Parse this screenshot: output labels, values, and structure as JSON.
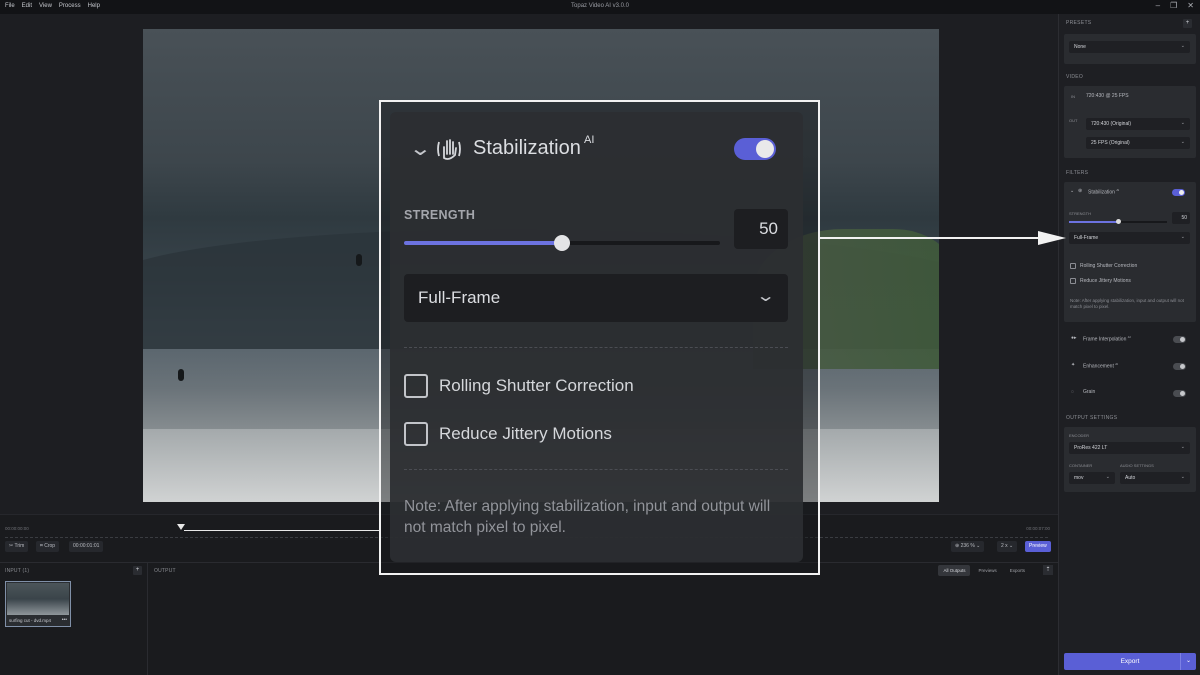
{
  "window": {
    "title": "Topaz Video AI  v3.0.0",
    "menu": [
      "File",
      "Edit",
      "View",
      "Process",
      "Help"
    ],
    "controls": [
      "–",
      "❐",
      "✕"
    ]
  },
  "timeline": {
    "start_time": "00:00:00:00",
    "end_time": "00:00:07:00",
    "trim_label": "Trim",
    "crop_label": "Crop",
    "position": "00:00:01:01",
    "zoom": "236 %",
    "speed": "2 x",
    "preview_label": "Preview"
  },
  "input_pane": {
    "label": "INPUT (1)",
    "add_label": "+",
    "file_name": "surfing cut - dvd.mp4",
    "more_label": "•••"
  },
  "output_pane": {
    "label": "OUTPUT",
    "tabs": [
      "All Outputs",
      "Previews",
      "Exports"
    ],
    "upload_label": "⇡"
  },
  "sidebar": {
    "presets": {
      "label": "PRESETS",
      "add_label": "+",
      "selected": "None"
    },
    "video": {
      "label": "VIDEO",
      "in_tag": "IN",
      "in_value": "720:430 @ 25 FPS",
      "out_tag": "OUT",
      "resolution": "720:430 (Original)",
      "fps": "25 FPS (Original)"
    },
    "filters": {
      "label": "FILTERS",
      "stabilization": {
        "name": "Stabilization",
        "ai": "AI",
        "strength_label": "STRENGTH",
        "strength_value": "50",
        "mode": "Full-Frame",
        "rolling_shutter": "Rolling Shutter Correction",
        "reduce_jittery": "Reduce Jittery Motions",
        "note": "Note: After applying stabilization, input and output will not match pixel to pixel."
      },
      "frame_interpolation": {
        "name": "Frame Interpolation",
        "ai": "AI"
      },
      "enhancement": {
        "name": "Enhancement",
        "ai": "AI"
      },
      "grain": {
        "name": "Grain"
      }
    },
    "output_settings": {
      "label": "OUTPUT SETTINGS",
      "encoder_label": "ENCODER",
      "encoder": "ProRes 422 LT",
      "container_label": "CONTAINER",
      "container": "mov",
      "audio_label": "AUDIO SETTINGS",
      "audio": "Auto"
    },
    "export_label": "Export"
  },
  "zoom_panel": {
    "title": "Stabilization",
    "ai": "AI",
    "enabled": true,
    "strength_label": "STRENGTH",
    "strength_value": "50",
    "strength_fraction": 0.5,
    "mode": "Full-Frame",
    "rolling_shutter": "Rolling Shutter Correction",
    "reduce_jittery": "Reduce Jittery Motions",
    "note": "Note: After applying stabilization, input and output will not match pixel to pixel."
  },
  "colors": {
    "accent": "#5a5fd6",
    "slider_fill": "#6c72e0",
    "callout_border": "#f2f2f2"
  }
}
